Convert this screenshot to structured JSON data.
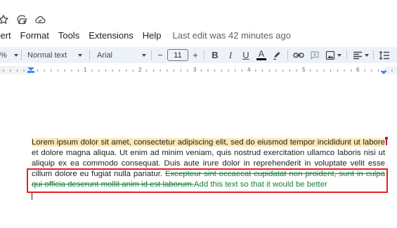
{
  "title_bar": {
    "icons": [
      "star-icon",
      "move-to-folder-icon",
      "cloud-saved-icon"
    ]
  },
  "menu": {
    "items": [
      "sert",
      "Format",
      "Tools",
      "Extensions",
      "Help"
    ],
    "last_edit": "Last edit was 42 minutes ago"
  },
  "toolbar": {
    "zoom_suffix": "%",
    "style": "Normal text",
    "font": "Arial",
    "size": "11",
    "minus": "−",
    "plus": "+",
    "bold": "B",
    "italic": "I",
    "underline": "U",
    "text_color": "A"
  },
  "ruler": {
    "numbers": [
      "1",
      "2",
      "3",
      "4",
      "5",
      "6"
    ]
  },
  "document": {
    "highlighted": "Lorem ipsum dolor sit amet, consectetur adipiscing elit, sed do eiusmod tempor incididunt ut labore",
    "plain": " et dolore magna aliqua. Ut enim ad minim veniam, quis nostrud exercitation ullamco laboris nisi ut aliquip ex ea commodo consequat. Duis aute irure dolor in reprehenderit in voluptate velit esse cillum dolore eu fugiat nulla pariatur. ",
    "deleted": "Excepteur sint occaecat cupidatat non proident, sunt in culpa qui officia deserunt mollit anim id est laborum.",
    "inserted": "Add this text so that it would be better"
  },
  "colors": {
    "suggestion": "#188038",
    "highlight": "#fce8b2",
    "annotation_box": "#e51f24",
    "toolbar_bg": "#edf2fa"
  }
}
